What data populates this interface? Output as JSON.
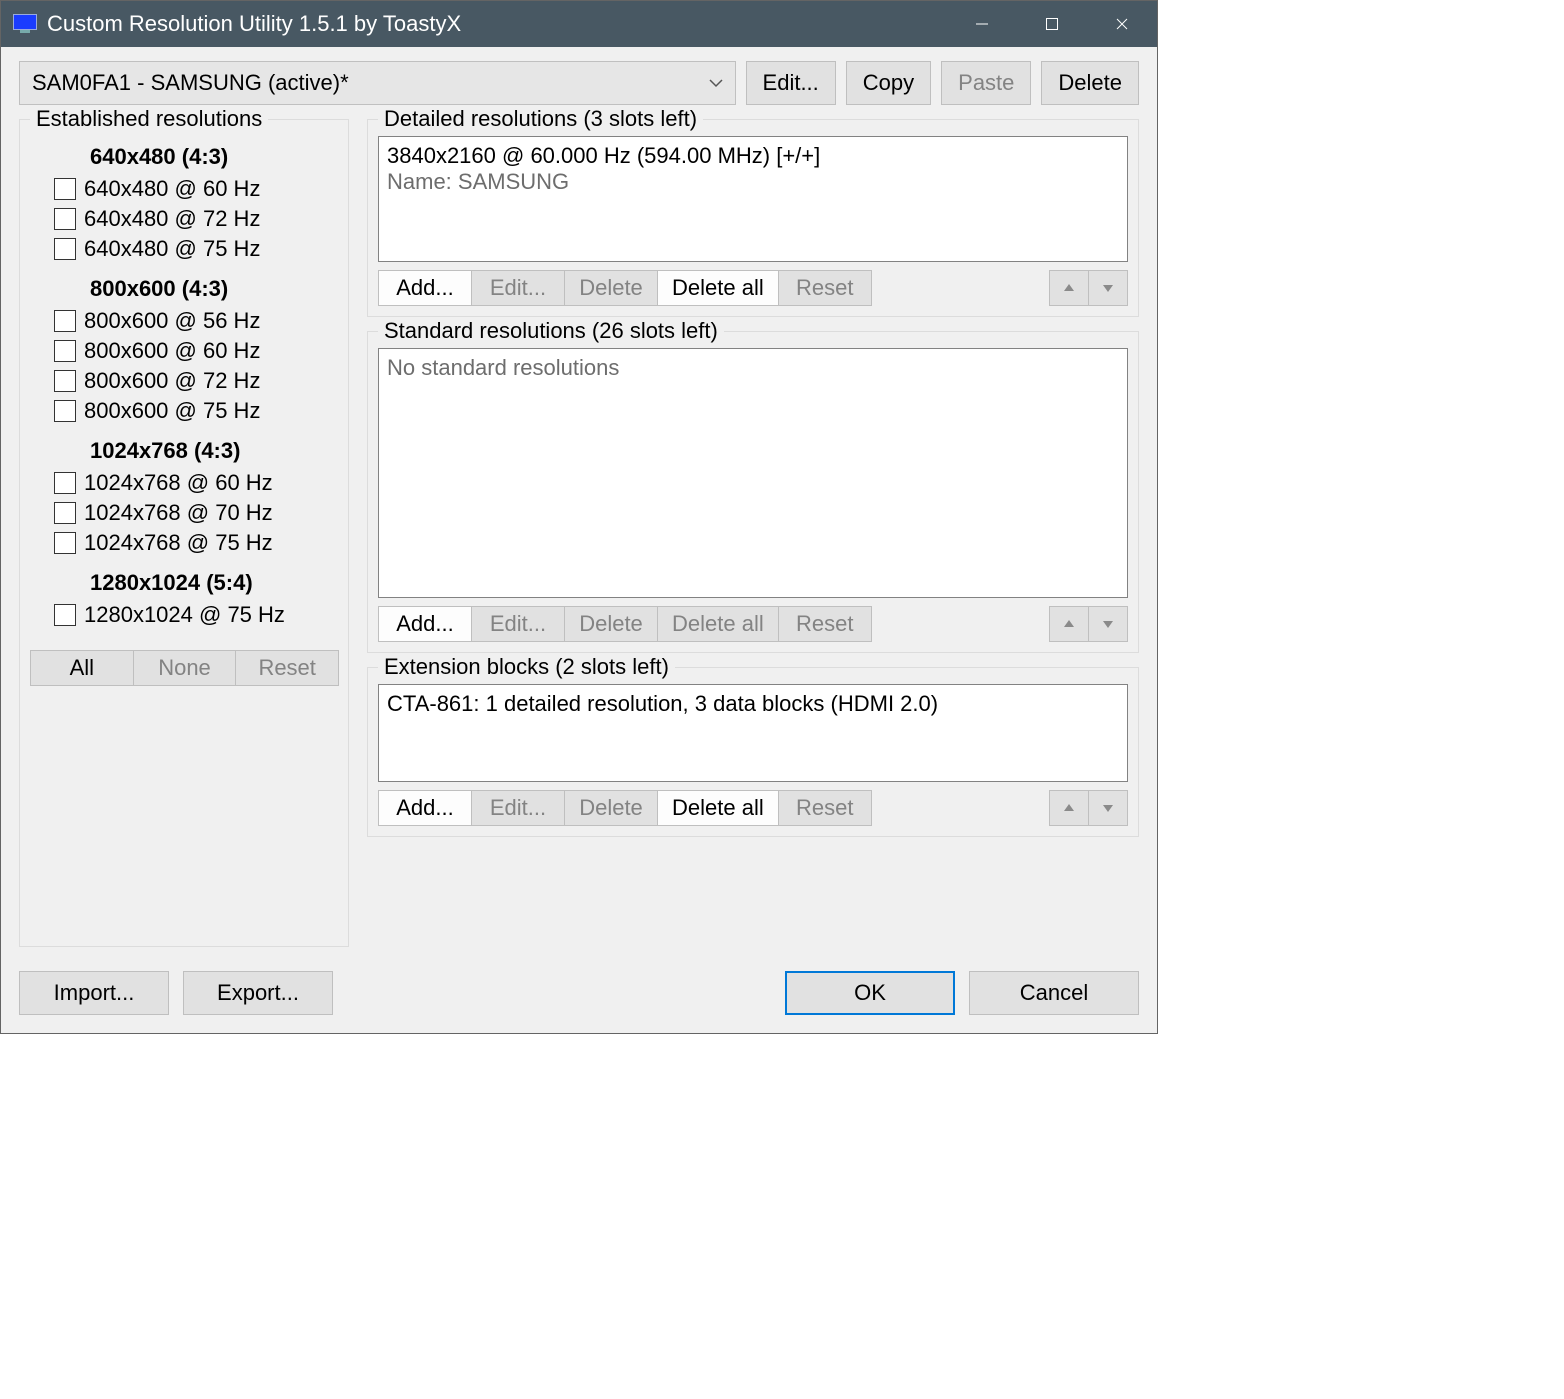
{
  "titlebar": {
    "title": "Custom Resolution Utility 1.5.1 by ToastyX"
  },
  "top": {
    "display_selected": "SAM0FA1 - SAMSUNG (active)*",
    "edit": "Edit...",
    "copy": "Copy",
    "paste": "Paste",
    "delete": "Delete"
  },
  "established": {
    "legend": "Established resolutions",
    "groups": [
      {
        "header": "640x480 (4:3)",
        "items": [
          "640x480 @ 60 Hz",
          "640x480 @ 72 Hz",
          "640x480 @ 75 Hz"
        ]
      },
      {
        "header": "800x600 (4:3)",
        "items": [
          "800x600 @ 56 Hz",
          "800x600 @ 60 Hz",
          "800x600 @ 72 Hz",
          "800x600 @ 75 Hz"
        ]
      },
      {
        "header": "1024x768 (4:3)",
        "items": [
          "1024x768 @ 60 Hz",
          "1024x768 @ 70 Hz",
          "1024x768 @ 75 Hz"
        ]
      },
      {
        "header": "1280x1024 (5:4)",
        "items": [
          "1280x1024 @ 75 Hz"
        ]
      }
    ],
    "all": "All",
    "none": "None",
    "reset": "Reset"
  },
  "detailed": {
    "legend": "Detailed resolutions (3 slots left)",
    "line1": "3840x2160 @ 60.000 Hz (594.00 MHz) [+/+]",
    "line2": "Name: SAMSUNG",
    "add": "Add...",
    "edit": "Edit...",
    "delete": "Delete",
    "delete_all": "Delete all",
    "reset": "Reset"
  },
  "standard": {
    "legend": "Standard resolutions (26 slots left)",
    "placeholder": "No standard resolutions",
    "add": "Add...",
    "edit": "Edit...",
    "delete": "Delete",
    "delete_all": "Delete all",
    "reset": "Reset"
  },
  "extension": {
    "legend": "Extension blocks (2 slots left)",
    "line1": "CTA-861: 1 detailed resolution, 3 data blocks (HDMI 2.0)",
    "add": "Add...",
    "edit": "Edit...",
    "delete": "Delete",
    "delete_all": "Delete all",
    "reset": "Reset"
  },
  "bottom": {
    "import": "Import...",
    "export": "Export...",
    "ok": "OK",
    "cancel": "Cancel"
  }
}
